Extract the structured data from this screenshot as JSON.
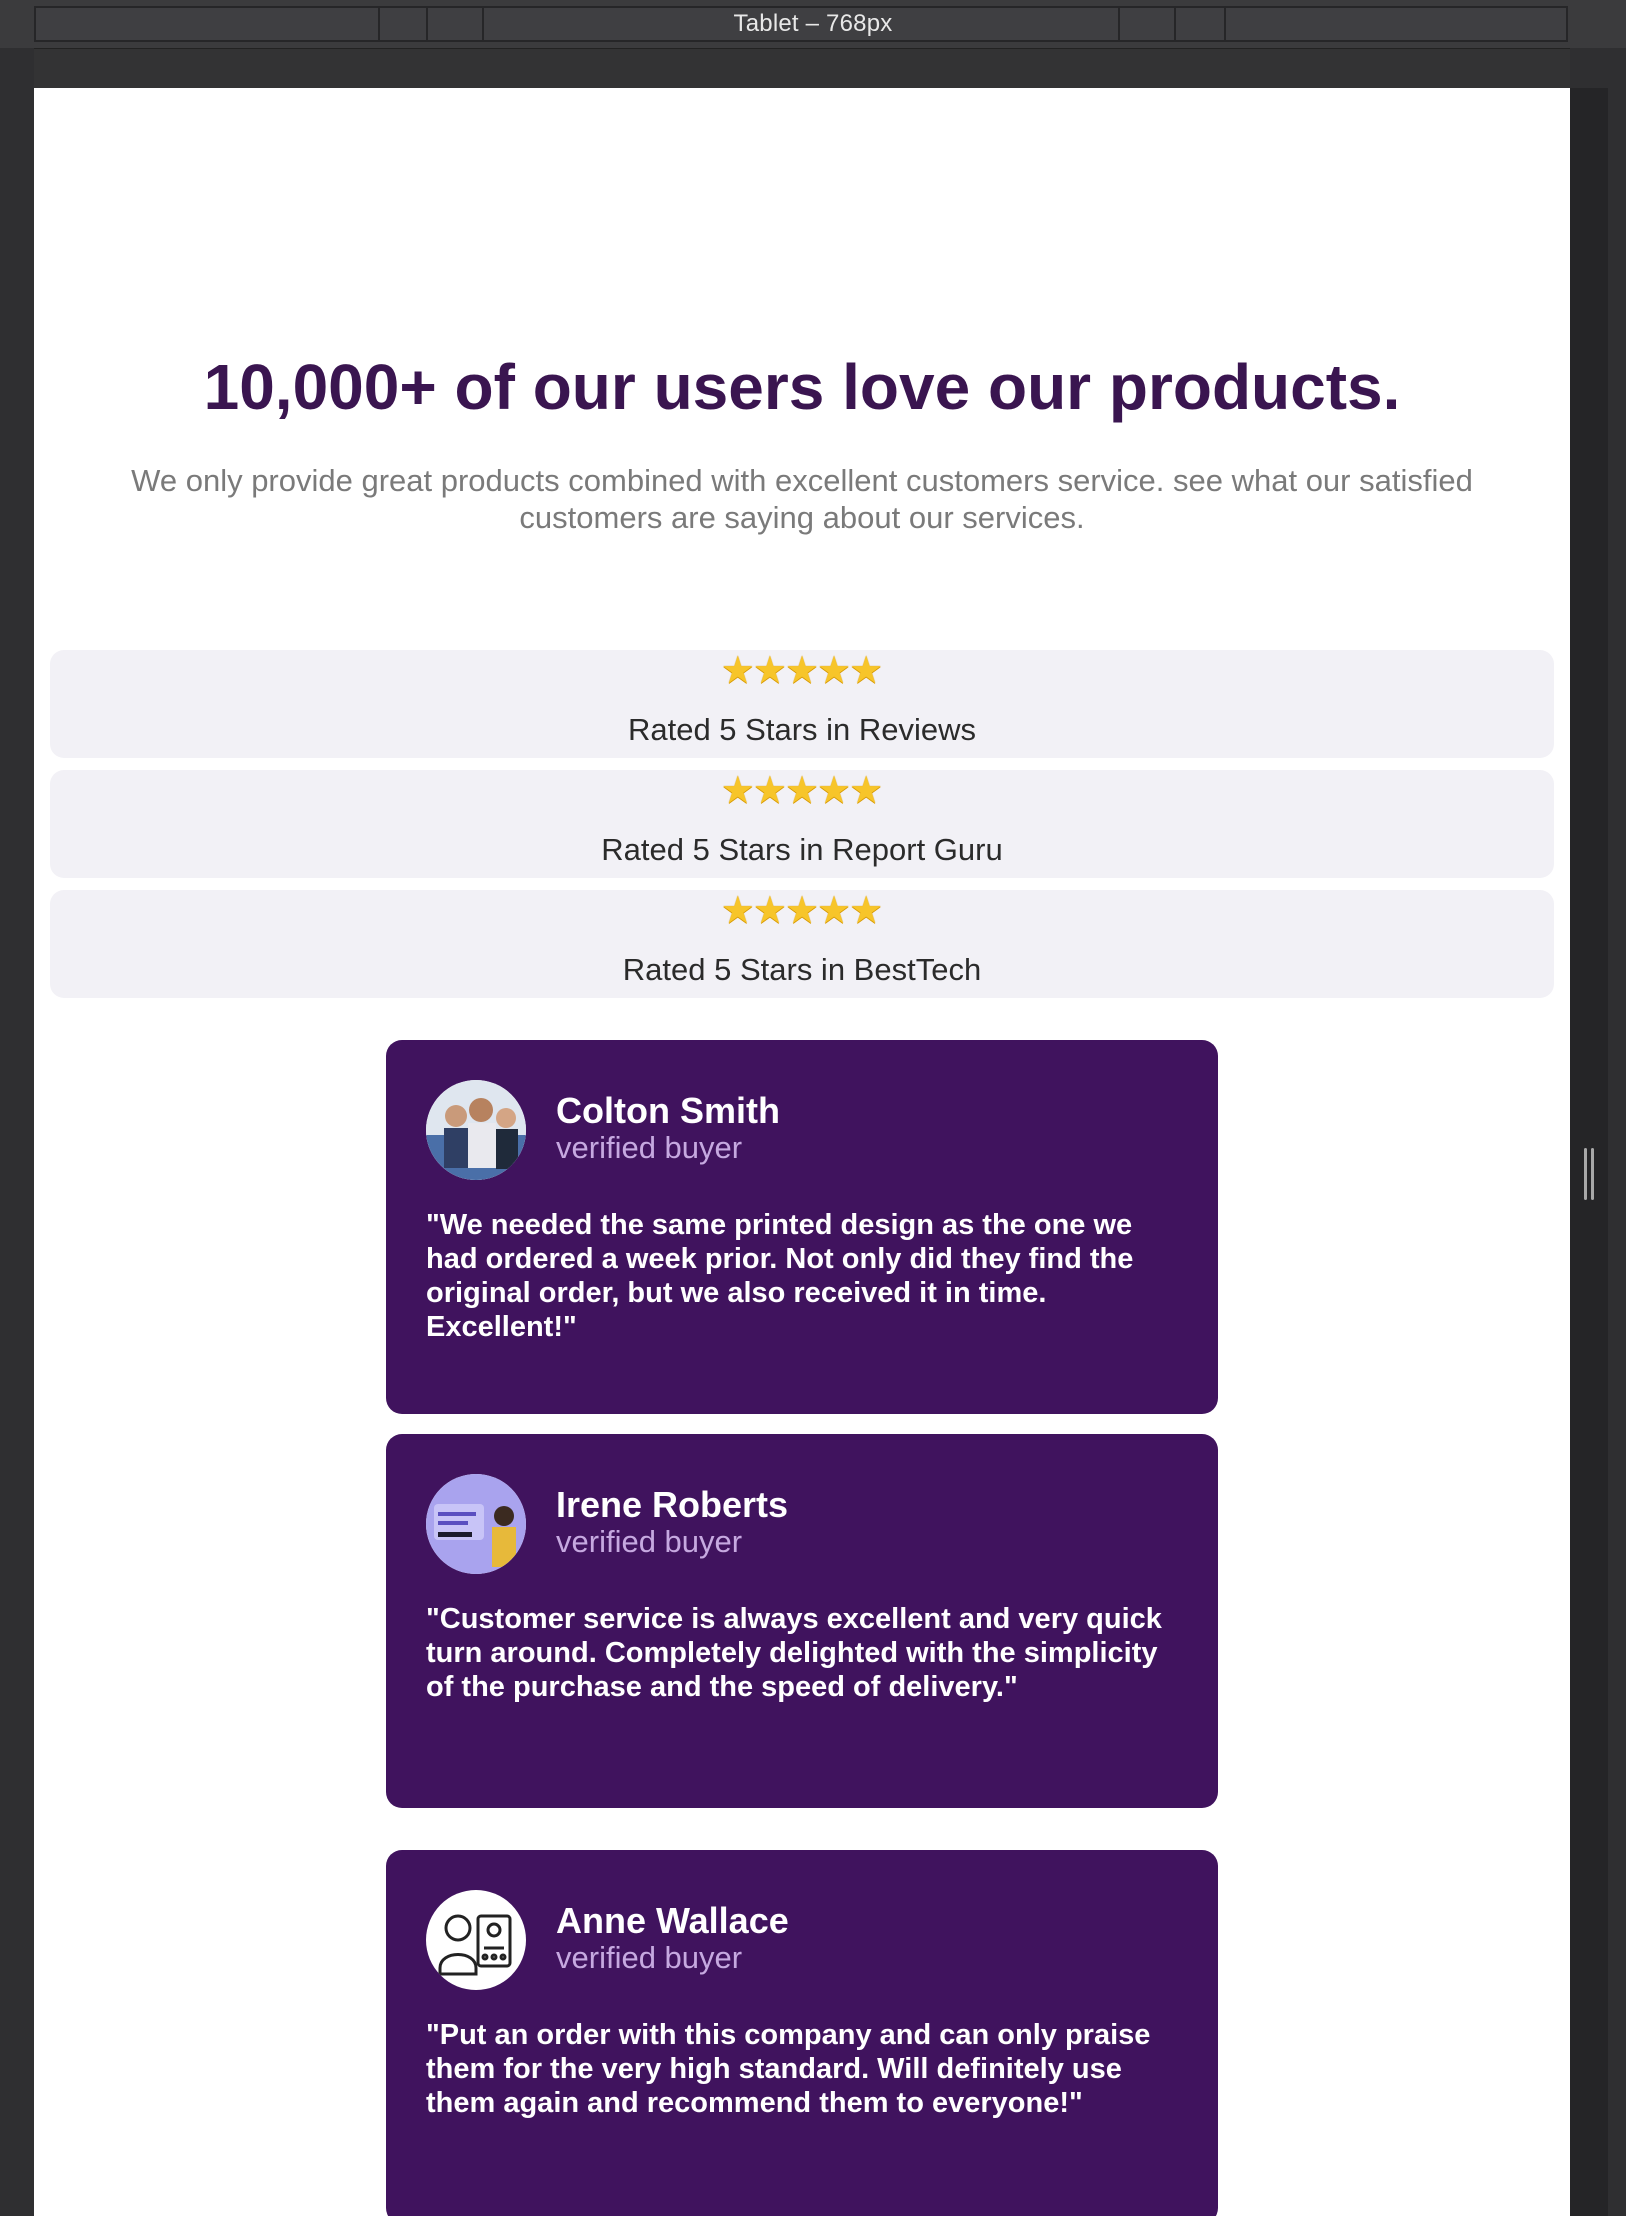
{
  "devtools": {
    "title": "Tablet – 768px"
  },
  "page": {
    "headline": "10,000+ of our users love our products.",
    "subtext": "We only provide great products combined with excellent customers service. see what our satisfied customers are saying about our services."
  },
  "ratings": [
    {
      "stars": "★★★★★",
      "label": "Rated 5 Stars in Reviews"
    },
    {
      "stars": "★★★★★",
      "label": "Rated 5 Stars in Report Guru"
    },
    {
      "stars": "★★★★★",
      "label": "Rated 5 Stars in BestTech"
    }
  ],
  "reviews": [
    {
      "name": "Colton Smith",
      "role": "verified buyer",
      "quote": "\"We needed the same printed design as the one we had ordered a week prior. Not only did they find the original order, but we also received it in time. Excellent!\"",
      "avatar": "people-photo-avatar"
    },
    {
      "name": "Irene Roberts",
      "role": "verified buyer",
      "quote": "\"Customer service is always excellent and very quick turn around. Completely delighted with the simplicity of the purchase and the speed of delivery.\"",
      "avatar": "social-proof-avatar"
    },
    {
      "name": "Anne Wallace",
      "role": "verified buyer",
      "quote": "\"Put an order with this company and can only praise them for the very high standard. Will definitely use them again and recommend them to everyone!\"",
      "avatar": "reviewer-line-icon-avatar"
    }
  ],
  "colors": {
    "accent": "#40135e",
    "headline": "#3a1550",
    "star": "#f7c52a"
  }
}
